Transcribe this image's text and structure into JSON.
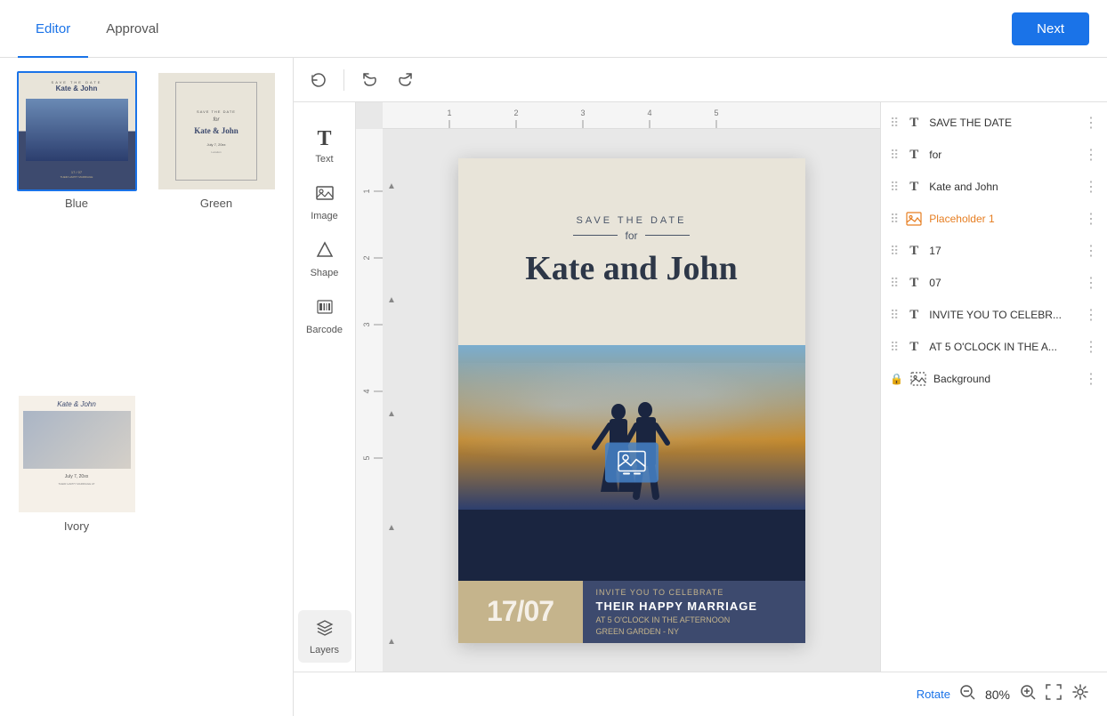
{
  "header": {
    "tab_editor": "Editor",
    "tab_approval": "Approval",
    "next_btn": "Next",
    "active_tab": "editor"
  },
  "left_panel": {
    "thumbnails": [
      {
        "id": "blue",
        "label": "Blue",
        "selected": true
      },
      {
        "id": "green",
        "label": "Green",
        "selected": false
      },
      {
        "id": "ivory",
        "label": "Ivory",
        "selected": false
      }
    ]
  },
  "toolbar": {
    "history_icon": "↺",
    "undo_icon": "↩",
    "redo_icon": "↪"
  },
  "tools": [
    {
      "id": "text",
      "icon": "T",
      "label": "Text"
    },
    {
      "id": "image",
      "icon": "🖼",
      "label": "Image"
    },
    {
      "id": "shape",
      "icon": "◇",
      "label": "Shape"
    },
    {
      "id": "barcode",
      "icon": "⊞",
      "label": "Barcode"
    },
    {
      "id": "layers",
      "icon": "≡",
      "label": "Layers"
    }
  ],
  "canvas": {
    "card": {
      "save_the_date": "SAVE THE DATE",
      "for": "for",
      "names": "Kate and John",
      "date_num": "17/07",
      "invite": "INVITE YOU TO CELEBRATE",
      "marriage": "THEIR HAPPY MARRIAGE",
      "time": "AT 5 O'CLOCK IN THE AFTERNOON",
      "place": "GREEN GARDEN - NY"
    }
  },
  "layers": [
    {
      "id": "save-the-date",
      "name": "SAVE THE DATE",
      "type": "text",
      "locked": false
    },
    {
      "id": "for",
      "name": "for",
      "type": "text",
      "locked": false
    },
    {
      "id": "kate-and-john",
      "name": "Kate and John",
      "type": "text",
      "locked": false
    },
    {
      "id": "placeholder1",
      "name": "Placeholder 1",
      "type": "image",
      "locked": false,
      "orange": true
    },
    {
      "id": "17",
      "name": "17",
      "type": "text",
      "locked": false
    },
    {
      "id": "07",
      "name": "07",
      "type": "text",
      "locked": false
    },
    {
      "id": "invite",
      "name": "INVITE YOU TO CELEBR...",
      "type": "text",
      "locked": false
    },
    {
      "id": "at5",
      "name": "AT 5 O'CLOCK IN THE A...",
      "type": "text",
      "locked": false
    },
    {
      "id": "background",
      "name": "Background",
      "type": "image",
      "locked": true
    }
  ],
  "footer": {
    "rotate": "Rotate",
    "zoom_out": "−",
    "zoom_pct": "80%",
    "zoom_in": "+"
  }
}
